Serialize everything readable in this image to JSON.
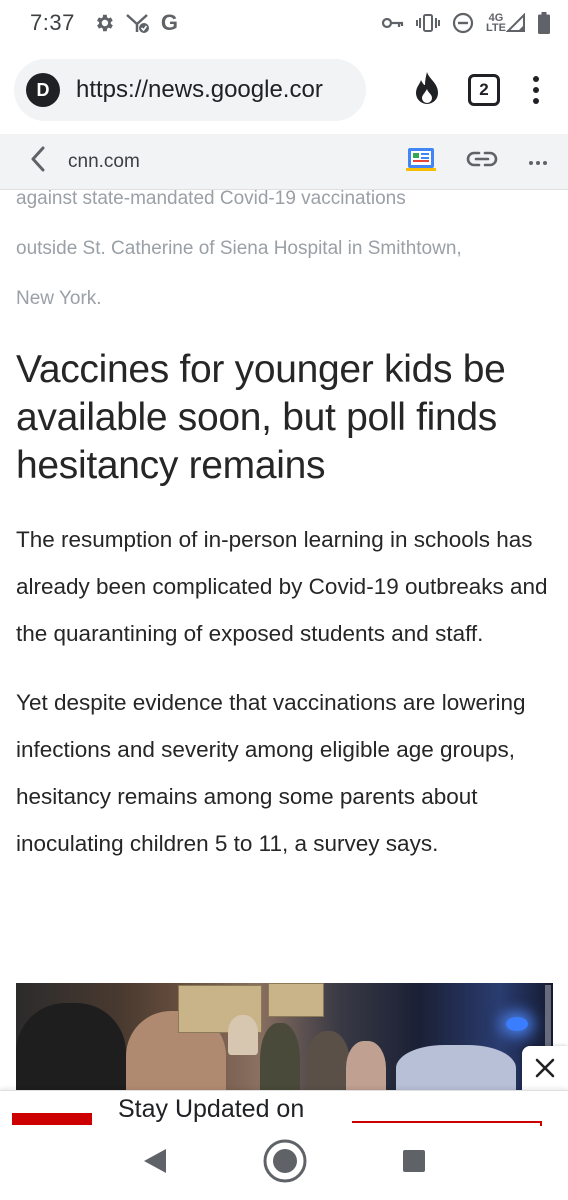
{
  "status_bar": {
    "time": "7:37",
    "left_icons": [
      "gear-icon",
      "signal-check-icon",
      "google-g-icon"
    ],
    "google_letter": "G",
    "right_icons": [
      "vpn-key-icon",
      "vibrate-icon",
      "do-not-disturb-icon",
      "lte-signal-icon",
      "battery-icon"
    ],
    "network_label_top": "4G",
    "network_label_bottom": "LTE"
  },
  "browser": {
    "site_badge": "D",
    "url": "https://news.google.cor",
    "tab_count": "2",
    "icons": [
      "flame-icon",
      "tab-switcher-icon",
      "menu-icon"
    ]
  },
  "amp_bar": {
    "domain": "cnn.com",
    "icons": [
      "back-arrow-icon",
      "news-publisher-icon",
      "link-icon",
      "more-icon"
    ]
  },
  "article": {
    "caption_lines": [
      "against state-mandated Covid-19 vaccinations",
      "outside St. Catherine of Siena Hospital in Smithtown,",
      "New York."
    ],
    "headline": "Vaccines for younger kids be available soon, but poll finds hesitancy remains",
    "paragraphs": [
      "The resumption of in-person learning in schools has already been complicated by Covid-19 outbreaks and the quarantining of exposed students and staff.",
      "Yet despite evidence that vaccinations are lowering infections and severity among eligible age groups, hesitancy remains among some parents about inoculating children 5 to 11, a survey says."
    ]
  },
  "ad": {
    "text": "Stay Updated on",
    "close_icon": "close-icon",
    "accent_color": "#cc0000"
  },
  "nav_bar": {
    "icons": [
      "back-triangle-icon",
      "home-circle-icon",
      "recents-square-icon"
    ]
  }
}
